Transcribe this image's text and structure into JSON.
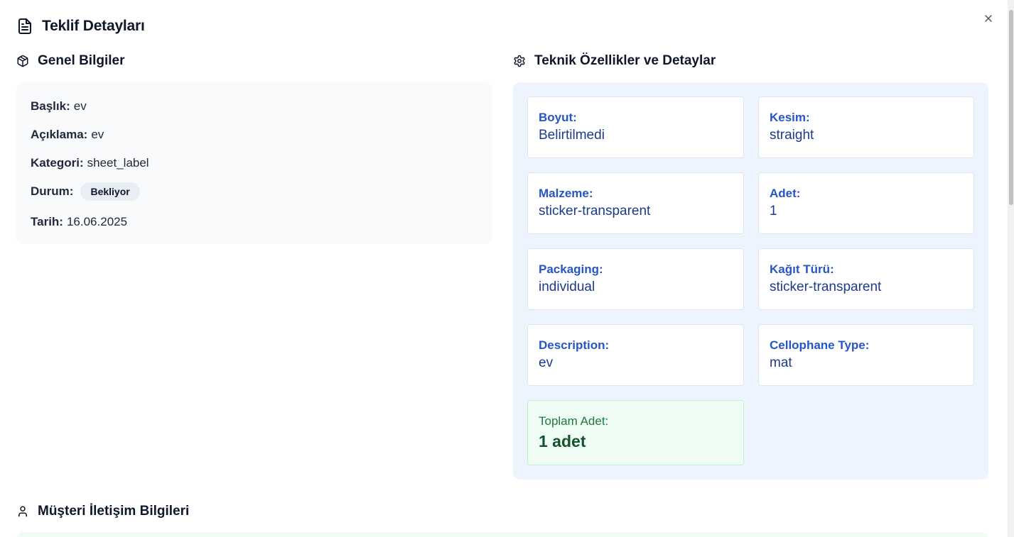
{
  "dialog": {
    "title": "Teklif Detayları",
    "close_icon": "x-icon"
  },
  "general": {
    "heading": "Genel Bilgiler",
    "icon": "package-icon",
    "fields": [
      {
        "key": "Başlık:",
        "value": "ev"
      },
      {
        "key": "Açıklama:",
        "value": "ev"
      },
      {
        "key": "Kategori:",
        "value": "sheet_label"
      },
      {
        "key": "Durum:",
        "value": "Bekliyor"
      },
      {
        "key": "Tarih:",
        "value": "16.06.2025"
      }
    ]
  },
  "technical": {
    "heading": "Teknik Özellikler ve Detaylar",
    "icon": "gear-icon",
    "items": [
      {
        "label": "Boyut:",
        "value": "Belirtilmedi"
      },
      {
        "label": "Kesim:",
        "value": "straight"
      },
      {
        "label": "Malzeme:",
        "value": "sticker-transparent"
      },
      {
        "label": "Adet:",
        "value": "1"
      },
      {
        "label": "Packaging:",
        "value": "individual"
      },
      {
        "label": "Kağıt Türü:",
        "value": "sticker-transparent"
      },
      {
        "label": "Description:",
        "value": "ev"
      },
      {
        "label": "Cellophane Type:",
        "value": "mat"
      }
    ],
    "total": {
      "label": "Toplam Adet:",
      "value": "1 adet"
    }
  },
  "contact": {
    "heading": "Müşteri İletişim Bilgileri",
    "icon": "user-icon"
  },
  "colors": {
    "tech_label": "#2655c7",
    "tech_value": "#1e3a8a",
    "tech_panel_bg": "#eef4fd",
    "total_bg": "#effcf3",
    "total_label": "#1e7a3f",
    "total_value": "#14532d",
    "general_bg": "#f8fafc"
  }
}
